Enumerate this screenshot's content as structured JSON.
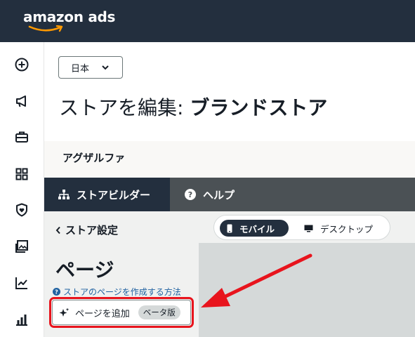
{
  "header": {
    "logo": "amazon ads"
  },
  "rail": {
    "icons": [
      "plus-circle-icon",
      "megaphone-icon",
      "briefcase-icon",
      "apps-grid-icon",
      "shield-heart-icon",
      "image-gallery-icon",
      "line-chart-icon",
      "bar-chart-icon"
    ]
  },
  "country_select": {
    "value": "日本"
  },
  "page": {
    "title_prefix": "ストアを編集: ",
    "title_name": "ブランドストア"
  },
  "brand": {
    "name": "アグザルファ"
  },
  "tabs": {
    "builder": "ストアビルダー",
    "help": "ヘルプ"
  },
  "left_panel": {
    "back_label": "ストア設定",
    "section_title": "ページ",
    "help_link": "ストアのページを作成する方法",
    "add_page_label": "ページを追加",
    "beta_badge": "ベータ版"
  },
  "preview": {
    "mobile_label": "モバイル",
    "desktop_label": "デスクトップ"
  },
  "colors": {
    "topbar": "#232f3e",
    "highlight": "#e8141d",
    "link": "#2162a1"
  }
}
